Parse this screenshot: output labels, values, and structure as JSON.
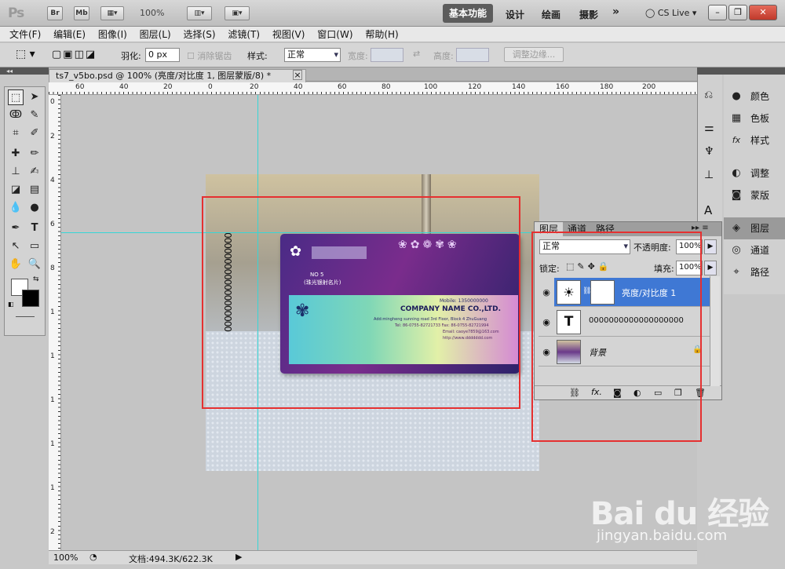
{
  "app": {
    "logo": "Ps",
    "top_buttons": [
      "Br",
      "Mb"
    ],
    "zoom_display": "100%",
    "workspace": {
      "active": "基本功能",
      "others": [
        "设计",
        "绘画",
        "摄影"
      ],
      "more": "»"
    },
    "cs_live": "CS Live",
    "window_controls": [
      "–",
      "❐",
      "✕"
    ]
  },
  "menu": [
    "文件(F)",
    "编辑(E)",
    "图像(I)",
    "图层(L)",
    "选择(S)",
    "滤镜(T)",
    "视图(V)",
    "窗口(W)",
    "帮助(H)"
  ],
  "options": {
    "feather_label": "羽化:",
    "feather_value": "0 px",
    "antialias_label": "消除锯齿",
    "style_label": "样式:",
    "style_value": "正常",
    "width_label": "宽度:",
    "height_label": "高度:",
    "refine_edge": "调整边缘..."
  },
  "document": {
    "tab_title": "ts7_v5bo.psd @ 100% (亮度/对比度 1, 图层蒙版/8) *",
    "tab_close": "×",
    "ruler_h_labels": [
      "60",
      "40",
      "20",
      "0",
      "20",
      "40",
      "60",
      "80",
      "100",
      "120",
      "140",
      "160",
      "180",
      "200"
    ],
    "ruler_v_labels": [
      "0",
      "2",
      "4",
      "6",
      "8",
      "1",
      "1",
      "1",
      "1",
      "1",
      "2"
    ],
    "vertical_text": "0000000000000000000",
    "card": {
      "no": "NO 5",
      "subtitle": "(珠光银射名片)",
      "mobile": "Mobile: 1350000000",
      "company": "COMPANY NAME CO.,LTD.",
      "address": "Add:mingheng sunning road 3rd Floor, Block 4 ZhuGuang",
      "tel": "Tel: 86-0755-82721733  Fax: 86-0755-82721994",
      "email": "Email: caoye7859@163.com",
      "web": "http://www.ddddddd.com"
    }
  },
  "status": {
    "zoom": "100%",
    "doc_info": "文档:494.3K/622.3K"
  },
  "right_dock": {
    "items": [
      {
        "icon": "color-icon",
        "glyph": "●",
        "label": "颜色"
      },
      {
        "icon": "swatches-icon",
        "glyph": "▦",
        "label": "色板"
      },
      {
        "icon": "styles-icon",
        "glyph": "fx",
        "label": "样式"
      },
      {
        "icon": "adjustments-icon",
        "glyph": "◐",
        "label": "调整"
      },
      {
        "icon": "masks-icon",
        "glyph": "◙",
        "label": "蒙版"
      },
      {
        "icon": "layers-icon",
        "glyph": "◈",
        "label": "图层"
      },
      {
        "icon": "channels-icon",
        "glyph": "◎",
        "label": "通道"
      },
      {
        "icon": "paths-icon",
        "glyph": "⌖",
        "label": "路径"
      }
    ]
  },
  "layers_panel": {
    "tabs": [
      "图层",
      "通道",
      "路径"
    ],
    "blend_mode": "正常",
    "opacity_label": "不透明度:",
    "opacity_value": "100%",
    "lock_label": "锁定:",
    "fill_label": "填充:",
    "fill_value": "100%",
    "layers": [
      {
        "name": "亮度/对比度 1",
        "selected": true,
        "type": "adjustment"
      },
      {
        "name": "0000000000000000000",
        "selected": false,
        "type": "text"
      },
      {
        "name": "背景",
        "selected": false,
        "type": "background"
      }
    ]
  },
  "watermark": {
    "logo": "Bai du 经验",
    "url": "jingyan.baidu.com"
  }
}
